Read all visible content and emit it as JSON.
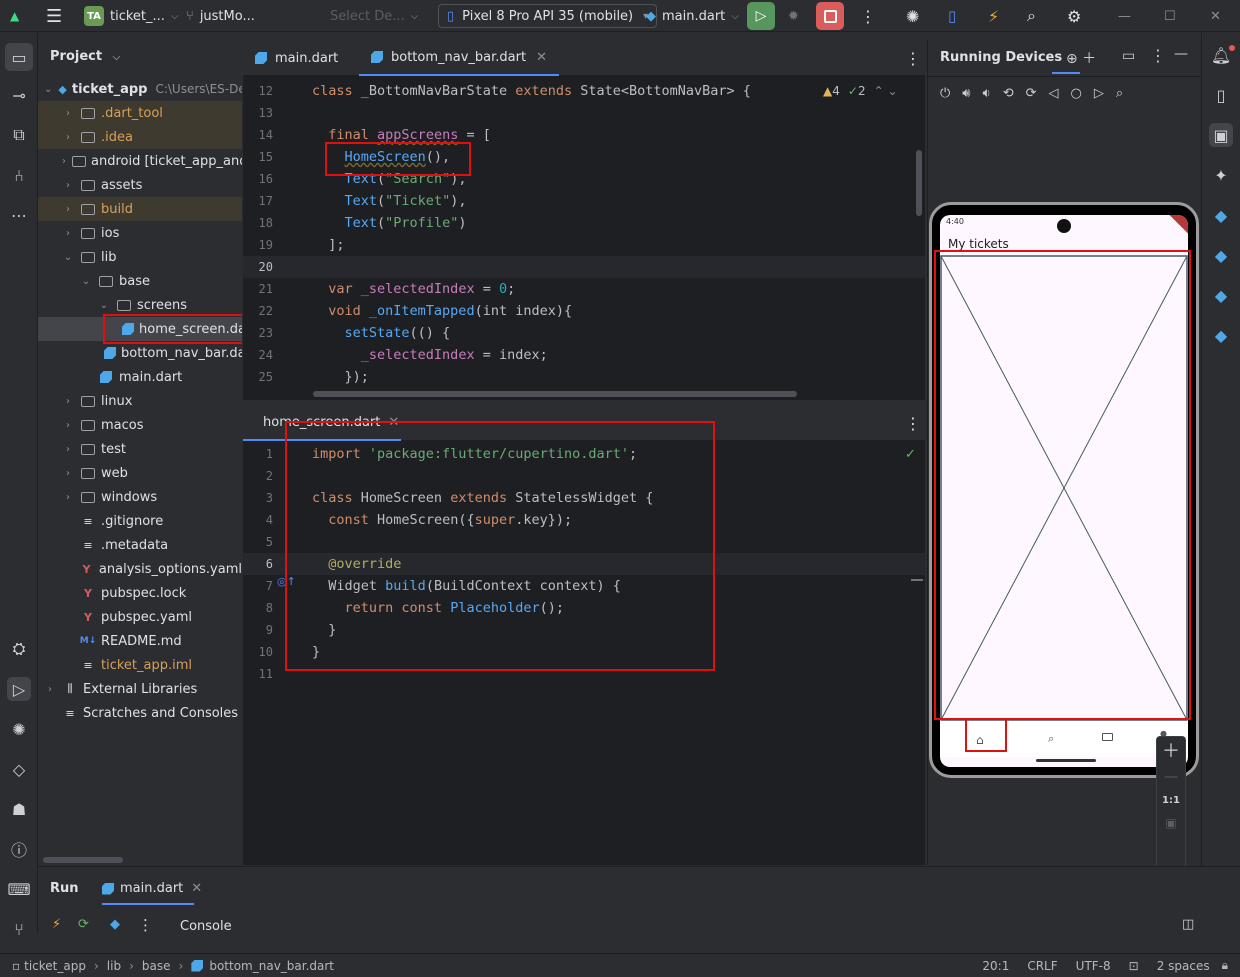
{
  "titlebar": {
    "project_badge": "TA",
    "project_name": "ticket_...",
    "branch": "justMo...",
    "config_placeholder": "Select De...",
    "device": "Pixel 8 Pro API 35 (mobile)",
    "run_config": "main.dart"
  },
  "project_panel": {
    "title": "Project",
    "rows": [
      {
        "label": "ticket_app",
        "suffix": "C:\\Users\\ES-Dev",
        "kind": "root"
      },
      {
        "label": ".dart_tool",
        "kind": "folder",
        "style": "orange"
      },
      {
        "label": ".idea",
        "kind": "folder",
        "style": "orange"
      },
      {
        "label": "android [ticket_app_andro",
        "kind": "folder"
      },
      {
        "label": "assets",
        "kind": "folder"
      },
      {
        "label": "build",
        "kind": "folder",
        "style": "orange"
      },
      {
        "label": "ios",
        "kind": "folder"
      },
      {
        "label": "lib",
        "kind": "folder"
      },
      {
        "label": "base",
        "kind": "folder"
      },
      {
        "label": "screens",
        "kind": "folder"
      },
      {
        "label": "home_screen.da",
        "kind": "dart"
      },
      {
        "label": "bottom_nav_bar.dar",
        "kind": "dart"
      },
      {
        "label": "main.dart",
        "kind": "dart"
      },
      {
        "label": "linux",
        "kind": "folder"
      },
      {
        "label": "macos",
        "kind": "folder"
      },
      {
        "label": "test",
        "kind": "folder"
      },
      {
        "label": "web",
        "kind": "folder"
      },
      {
        "label": "windows",
        "kind": "folder"
      },
      {
        "label": ".gitignore",
        "kind": "file"
      },
      {
        "label": ".metadata",
        "kind": "file"
      },
      {
        "label": "analysis_options.yaml",
        "kind": "yaml"
      },
      {
        "label": "pubspec.lock",
        "kind": "yaml"
      },
      {
        "label": "pubspec.yaml",
        "kind": "yaml"
      },
      {
        "label": "README.md",
        "kind": "md"
      },
      {
        "label": "ticket_app.iml",
        "kind": "file",
        "style": "orange"
      },
      {
        "label": "External Libraries",
        "kind": "lib"
      },
      {
        "label": "Scratches and Consoles",
        "kind": "scratch"
      }
    ]
  },
  "editor_top": {
    "tabs": [
      "main.dart",
      "bottom_nav_bar.dart"
    ],
    "warnings": "4",
    "checks": "2",
    "line_numbers": [
      "12",
      "13",
      "14",
      "15",
      "16",
      "17",
      "18",
      "19",
      "20",
      "21",
      "22",
      "23",
      "24",
      "25"
    ]
  },
  "editor_bottom": {
    "tab": "home_screen.dart",
    "line_numbers": [
      "1",
      "2",
      "3",
      "4",
      "5",
      "6",
      "7",
      "8",
      "9",
      "10",
      "11"
    ]
  },
  "running_devices": {
    "title": "Running Devices",
    "status_time": "4:40",
    "app_title": "My tickets",
    "zoom_label": "1:1"
  },
  "run_panel": {
    "title": "Run",
    "tab": "main.dart",
    "console": "Console"
  },
  "statusbar": {
    "breadcrumb": [
      "ticket_app",
      "lib",
      "base",
      "bottom_nav_bar.dart"
    ],
    "position": "20:1",
    "line_sep": "CRLF",
    "encoding": "UTF-8",
    "indent": "2 spaces"
  },
  "colors": {
    "highlight_red": "#e01010",
    "accent_blue": "#548af7",
    "run_green": "#57965c",
    "stop_red": "#db5c5c"
  }
}
